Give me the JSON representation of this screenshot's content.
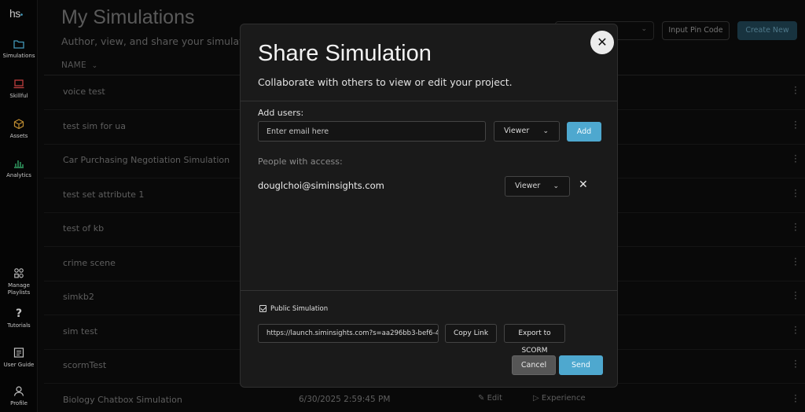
{
  "app": {
    "logo_text": "hs",
    "logo_dot": "•",
    "accent_color": "#4ea8cf"
  },
  "sidebar": {
    "items": [
      {
        "label": "Simulations",
        "icon": "folder-icon",
        "color": "#4fb3d9"
      },
      {
        "label": "Skillful",
        "icon": "laptop-icon",
        "color": "#e04a4a"
      },
      {
        "label": "Assets",
        "icon": "cube-icon",
        "color": "#e0a53a"
      },
      {
        "label": "Analytics",
        "icon": "bar-chart-icon",
        "color": "#3cc07a"
      },
      {
        "label_line1": "Manage",
        "label_line2": "Playlists",
        "icon": "playlist-icon"
      },
      {
        "label": "Tutorials",
        "icon": "question-icon",
        "glyph": "?"
      },
      {
        "label": "User Guide",
        "icon": "guide-icon"
      },
      {
        "label": "Profile",
        "icon": "user-icon"
      }
    ]
  },
  "page": {
    "title": "My Simulations",
    "subtitle": "Author, view, and share your simulations",
    "column_name": "NAME",
    "pin_button": "Input Pin Code",
    "create_button": "Create New",
    "rows": [
      {
        "name": "voice test"
      },
      {
        "name": "test sim for ua"
      },
      {
        "name": "Car Purchasing Negotiation Simulation"
      },
      {
        "name": "test set attribute 1"
      },
      {
        "name": "test of kb"
      },
      {
        "name": "crime scene"
      },
      {
        "name": "simkb2"
      },
      {
        "name": "sim test"
      },
      {
        "name": "scormTest"
      },
      {
        "name": "Biology Chatbox Simulation",
        "date": "6/30/2025 2:59:45 PM",
        "edit": "Edit",
        "experience": "Experience"
      }
    ]
  },
  "modal": {
    "title": "Share Simulation",
    "subtitle": "Collaborate with others to view or edit your project.",
    "close_glyph": "✕",
    "add_users_label": "Add users:",
    "email_placeholder": "Enter email here",
    "role_selected": "Viewer",
    "add_button": "Add",
    "people_label": "People with access:",
    "people": [
      {
        "email": "douglchoi@siminsights.com",
        "role": "Viewer"
      }
    ],
    "public_label": "Public Simulation",
    "public_checked": true,
    "link_value": "https://launch.siminsights.com?s=aa296bb3-bef6-4",
    "copy_link_button": "Copy Link",
    "export_button": "Export to SCORM",
    "cancel_button": "Cancel",
    "send_button": "Send"
  }
}
